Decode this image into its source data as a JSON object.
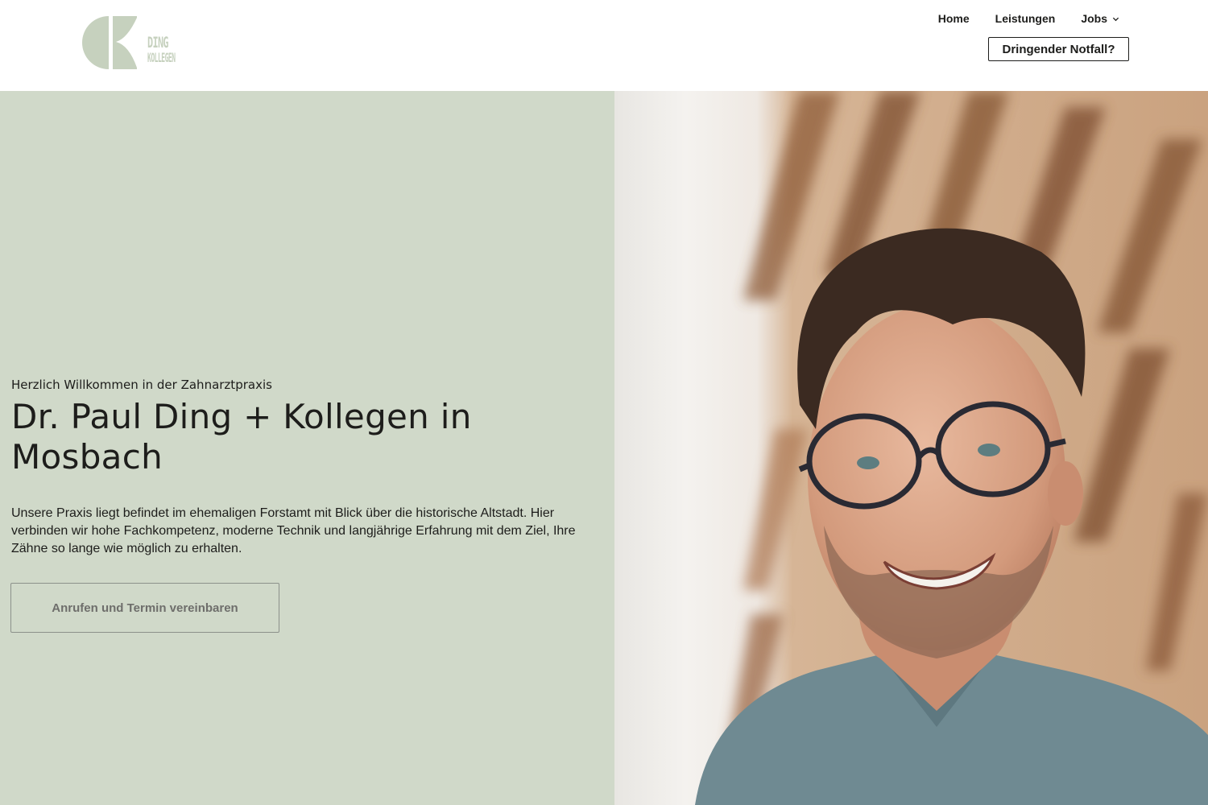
{
  "header": {
    "logo": {
      "icon": "practice-logo-k-mark",
      "text_line1": "DING",
      "text_line2": "KOLLEGEN",
      "color": "#c6d1be"
    },
    "nav": [
      {
        "label": "Home"
      },
      {
        "label": "Leistungen"
      },
      {
        "label": "Jobs",
        "icon": "chevron-down-icon"
      }
    ],
    "emergency_button": "Dringender Notfall?"
  },
  "hero": {
    "background_color": "#d0d9c9",
    "eyebrow": "Herzlich Willkommen in der Zahnarztpraxis",
    "headline": "Dr. Paul Ding + Kollegen in Mosbach",
    "intro": "Unsere Praxis liegt befindet im ehemaligen Forstamt mit Blick über die historische Altstadt. Hier verbinden wir hohe Fachkompetenz, moderne Technik und langjährige Erfahrung mit dem Ziel, Ihre Zähne so lange wie möglich zu erhalten.",
    "cta_button": "Anrufen und Termin vereinbaren",
    "photo": {
      "icon": "dentist-portrait-photo"
    }
  }
}
